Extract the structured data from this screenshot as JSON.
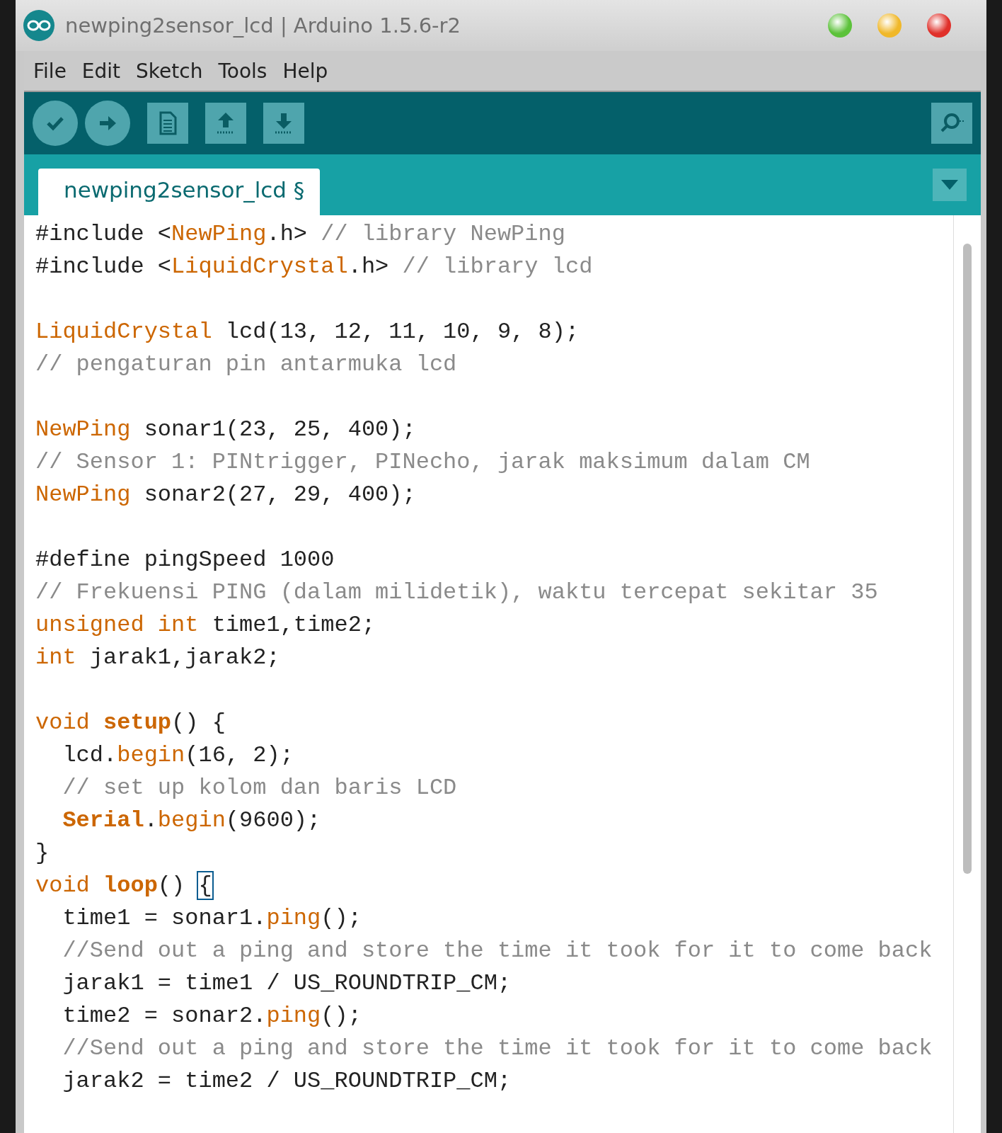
{
  "window": {
    "title": "newping2sensor_lcd | Arduino 1.5.6-r2"
  },
  "menu": [
    "File",
    "Edit",
    "Sketch",
    "Tools",
    "Help"
  ],
  "toolbar": [
    {
      "kind": "verify"
    },
    {
      "kind": "upload"
    },
    {
      "kind": "new"
    },
    {
      "kind": "open"
    },
    {
      "kind": "save"
    }
  ],
  "tabs": [
    {
      "label": "newping2sensor_lcd §",
      "selected": true
    }
  ],
  "editor": {
    "lines": [
      {
        "kind": "code",
        "tokens": [
          {
            "kind": "plain",
            "text": "#include <"
          },
          {
            "kind": "type",
            "text": "NewPing"
          },
          {
            "kind": "plain",
            "text": ".h> "
          },
          {
            "kind": "comment",
            "text": "// library NewPing"
          }
        ]
      },
      {
        "kind": "code",
        "tokens": [
          {
            "kind": "plain",
            "text": "#include <"
          },
          {
            "kind": "type",
            "text": "LiquidCrystal"
          },
          {
            "kind": "plain",
            "text": ".h> "
          },
          {
            "kind": "comment",
            "text": "// library lcd"
          }
        ]
      },
      {
        "kind": "blank"
      },
      {
        "kind": "code",
        "tokens": [
          {
            "kind": "type",
            "text": "LiquidCrystal"
          },
          {
            "kind": "plain",
            "text": " lcd(13, 12, 11, 10, 9, 8);"
          }
        ]
      },
      {
        "kind": "code",
        "tokens": [
          {
            "kind": "comment",
            "text": "// pengaturan pin antarmuka lcd"
          }
        ]
      },
      {
        "kind": "blank"
      },
      {
        "kind": "code",
        "tokens": [
          {
            "kind": "type",
            "text": "NewPing"
          },
          {
            "kind": "plain",
            "text": " sonar1(23, 25, 400);"
          }
        ]
      },
      {
        "kind": "code",
        "tokens": [
          {
            "kind": "comment",
            "text": "// Sensor 1: PINtrigger, PINecho, jarak maksimum dalam CM"
          }
        ]
      },
      {
        "kind": "code",
        "tokens": [
          {
            "kind": "type",
            "text": "NewPing"
          },
          {
            "kind": "plain",
            "text": " sonar2(27, 29, 400);"
          }
        ]
      },
      {
        "kind": "blank"
      },
      {
        "kind": "code",
        "tokens": [
          {
            "kind": "plain",
            "text": "#define pingSpeed 1000"
          }
        ]
      },
      {
        "kind": "code",
        "tokens": [
          {
            "kind": "comment",
            "text": "// Frekuensi PING (dalam milidetik), waktu tercepat sekitar 35"
          }
        ]
      },
      {
        "kind": "code",
        "tokens": [
          {
            "kind": "type",
            "text": "unsigned int"
          },
          {
            "kind": "plain",
            "text": " time1,time2;"
          }
        ]
      },
      {
        "kind": "code",
        "tokens": [
          {
            "kind": "type",
            "text": "int"
          },
          {
            "kind": "plain",
            "text": " jarak1,jarak2;"
          }
        ]
      },
      {
        "kind": "blank"
      },
      {
        "kind": "code",
        "tokens": [
          {
            "kind": "type",
            "text": "void "
          },
          {
            "kind": "func",
            "text": "setup"
          },
          {
            "kind": "plain",
            "text": "() {"
          }
        ]
      },
      {
        "kind": "code",
        "tokens": [
          {
            "kind": "plain",
            "text": "  lcd."
          },
          {
            "kind": "type",
            "text": "begin"
          },
          {
            "kind": "plain",
            "text": "(16, 2);"
          }
        ]
      },
      {
        "kind": "code",
        "tokens": [
          {
            "kind": "comment",
            "text": "  // set up kolom dan baris LCD"
          }
        ]
      },
      {
        "kind": "code",
        "tokens": [
          {
            "kind": "func",
            "text": "  Serial"
          },
          {
            "kind": "plain",
            "text": "."
          },
          {
            "kind": "type",
            "text": "begin"
          },
          {
            "kind": "plain",
            "text": "(9600);"
          }
        ]
      },
      {
        "kind": "code",
        "tokens": [
          {
            "kind": "plain",
            "text": "}"
          }
        ]
      },
      {
        "kind": "code",
        "tokens": [
          {
            "kind": "type",
            "text": "void "
          },
          {
            "kind": "func",
            "text": "loop"
          },
          {
            "kind": "plain",
            "text": "() "
          },
          {
            "kind": "bracket-match",
            "text": "{"
          }
        ]
      },
      {
        "kind": "code",
        "tokens": [
          {
            "kind": "plain",
            "text": "  time1 = sonar1."
          },
          {
            "kind": "type",
            "text": "ping"
          },
          {
            "kind": "plain",
            "text": "();"
          }
        ]
      },
      {
        "kind": "code",
        "tokens": [
          {
            "kind": "comment",
            "text": "  //Send out a ping and store the time it took for it to come back"
          }
        ]
      },
      {
        "kind": "code",
        "tokens": [
          {
            "kind": "plain",
            "text": "  jarak1 = time1 / US_ROUNDTRIP_CM;"
          }
        ]
      },
      {
        "kind": "code",
        "tokens": [
          {
            "kind": "plain",
            "text": "  time2 = sonar2."
          },
          {
            "kind": "type",
            "text": "ping"
          },
          {
            "kind": "plain",
            "text": "();"
          }
        ]
      },
      {
        "kind": "code",
        "tokens": [
          {
            "kind": "comment",
            "text": "  //Send out a ping and store the time it took for it to come back"
          }
        ]
      },
      {
        "kind": "code",
        "tokens": [
          {
            "kind": "plain",
            "text": "  jarak2 = time2 / US_ROUNDTRIP_CM;"
          }
        ]
      }
    ]
  }
}
